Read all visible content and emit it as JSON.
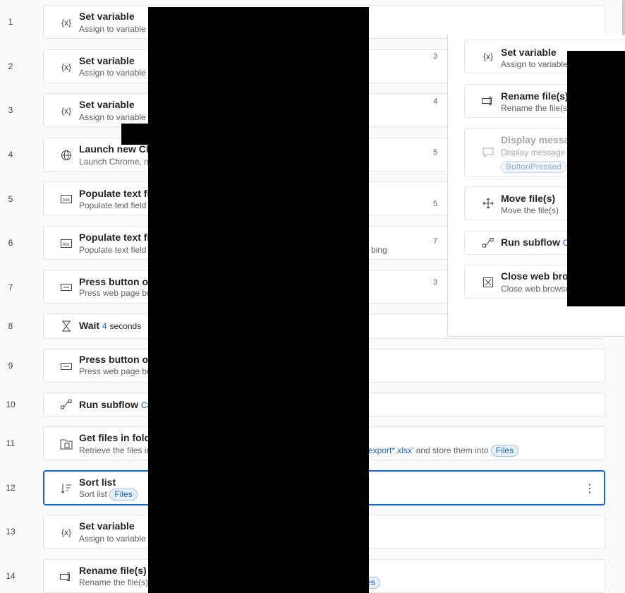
{
  "rows": [
    {
      "num": "1",
      "title": "Set variable",
      "desc": "Assign to variable",
      "icon": "variable-icon"
    },
    {
      "num": "2",
      "title": "Set variable",
      "desc": "Assign to variable",
      "icon": "variable-icon"
    },
    {
      "num": "3",
      "title": "Set variable",
      "desc": "Assign to variable",
      "icon": "variable-icon"
    },
    {
      "num": "4",
      "title": "Launch new Ch",
      "desc": "Launch Chrome, na",
      "icon": "globe-icon"
    },
    {
      "num": "5",
      "title": "Populate text fi",
      "desc": "Populate text field",
      "icon": "text-field-icon"
    },
    {
      "num": "6",
      "title": "Populate text fi",
      "desc": "Populate text field",
      "desc_tail": "bing",
      "icon": "text-field-icon"
    },
    {
      "num": "7",
      "title": "Press button or",
      "desc": "Press web page bu",
      "icon": "button-icon"
    },
    {
      "num": "8",
      "title": "Wait",
      "link": "4",
      "suffix": "seconds",
      "icon": "hourglass-icon"
    },
    {
      "num": "9",
      "title": "Press button or",
      "desc": "Press web page bu",
      "icon": "button-icon"
    },
    {
      "num": "10",
      "title": "Run subflow",
      "link": "Ca",
      "icon": "subflow-icon"
    },
    {
      "num": "11",
      "title": "Get files in fold",
      "desc": "Retrieve the files in",
      "desc_tail": "export*.xlsx'",
      "tail_after": "and store them into",
      "pill": "Files",
      "icon": "folder-files-icon"
    },
    {
      "num": "12",
      "title": "Sort list",
      "desc": "Sort list",
      "pill": "Files",
      "icon": "sort-icon"
    },
    {
      "num": "13",
      "title": "Set variable",
      "desc": "Assign to variable",
      "icon": "variable-icon"
    },
    {
      "num": "14",
      "title": "Rename file(s)",
      "desc": "Rename the file(s)",
      "pill": "es",
      "icon": "rename-icon"
    }
  ],
  "popup": [
    {
      "title": "Set variable",
      "desc": "Assign to variable",
      "icon": "variable-icon"
    },
    {
      "title": "Rename file(s)",
      "desc": "Rename the file(s)",
      "icon": "rename-icon"
    },
    {
      "title": "Display messag",
      "desc": "Display message",
      "pill": "ButtonPressed",
      "icon": "message-icon",
      "disabled": true
    },
    {
      "title": "Move file(s)",
      "desc": "Move the file(s)",
      "icon": "move-icon"
    },
    {
      "title": "Run subflow",
      "link": "Ca",
      "icon": "subflow-icon"
    },
    {
      "title": "Close web brow",
      "desc": "Close web browse",
      "icon": "close-browser-icon"
    }
  ],
  "edge_marks": [
    "3",
    "4",
    "5",
    "5",
    "7",
    "3"
  ]
}
